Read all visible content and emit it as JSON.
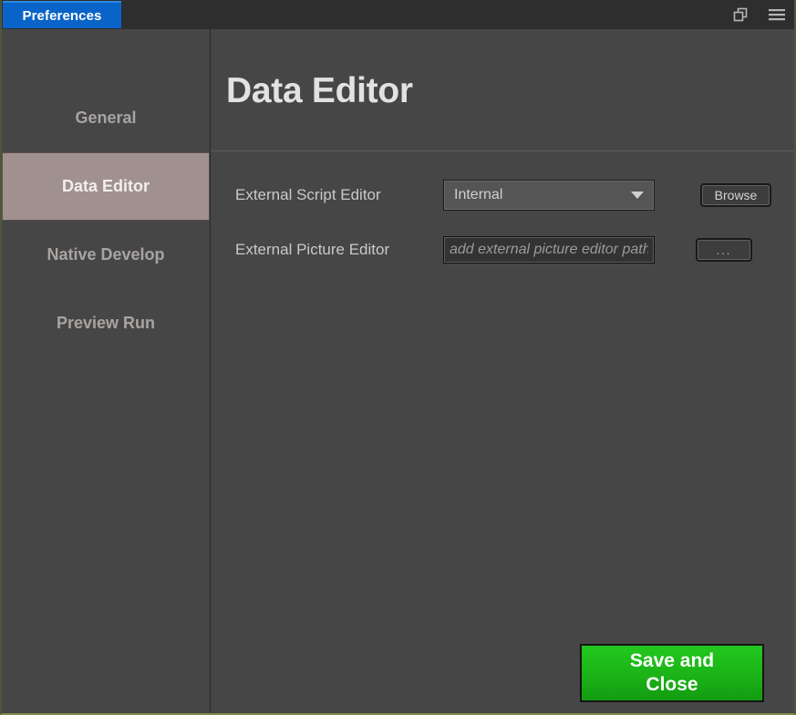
{
  "window": {
    "tab_label": "Preferences",
    "accent_tab_color": "#0a64c8",
    "restore_icon": "restore-window-icon",
    "menu_icon": "hamburger-menu-icon"
  },
  "sidebar": {
    "items": [
      {
        "label": "General",
        "active": false
      },
      {
        "label": "Data Editor",
        "active": true
      },
      {
        "label": "Native Develop",
        "active": false
      },
      {
        "label": "Preview Run",
        "active": false
      }
    ],
    "active_background": "#a1918e"
  },
  "content": {
    "page_title": "Data Editor",
    "rows": [
      {
        "label": "External Script Editor",
        "control": "dropdown",
        "value": "Internal",
        "dropdown_icon": "chevron-down-icon",
        "button_label": "Browse"
      },
      {
        "label": "External Picture Editor",
        "control": "textinput",
        "value": "",
        "placeholder": "add external picture editor path",
        "button_label": "..."
      }
    ]
  },
  "footer": {
    "save_close_label_line1": "Save and",
    "save_close_label_line2": "Close",
    "save_close_color": "#1bb318"
  }
}
